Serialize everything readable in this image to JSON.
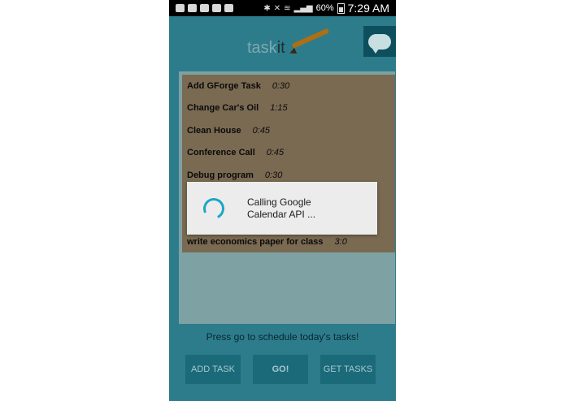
{
  "status_bar": {
    "battery": "60%",
    "time": "7:29 AM"
  },
  "header": {
    "logo_task": "task",
    "logo_it": "it"
  },
  "tasks": [
    {
      "name": "Add GForge Task",
      "duration": "0:30"
    },
    {
      "name": "Change Car's Oil",
      "duration": "1:15"
    },
    {
      "name": "Clean House",
      "duration": "0:45"
    },
    {
      "name": "Conference Call",
      "duration": "0:45"
    },
    {
      "name": "Debug program",
      "duration": "0:30"
    },
    {
      "name": "write economics paper for class",
      "duration": "3:0"
    }
  ],
  "footer": {
    "message": "Press go to schedule today's tasks!",
    "add_task_label": "ADD TASK",
    "go_label": "GO!",
    "get_tasks_label": "GET TASKS"
  },
  "dialog": {
    "message": "Calling Google Calendar API ..."
  }
}
